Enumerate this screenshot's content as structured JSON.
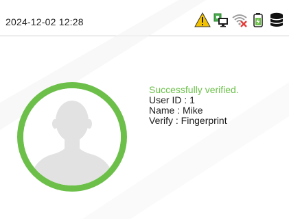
{
  "status_bar": {
    "datetime": "2024-12-02 12:28",
    "icons": [
      "warning-icon",
      "network-pc-icon",
      "wifi-off-icon",
      "battery-icon",
      "database-icon"
    ]
  },
  "verification": {
    "status_message": "Successfully verified.",
    "user_id_line": "User ID : 1",
    "name_line": "Name : Mike",
    "verify_line": "Verify :  Fingerprint"
  },
  "colors": {
    "success": "#6cc04a",
    "warning": "#f2c200",
    "network": "#4caf50",
    "wifi_off": "#e53935"
  }
}
